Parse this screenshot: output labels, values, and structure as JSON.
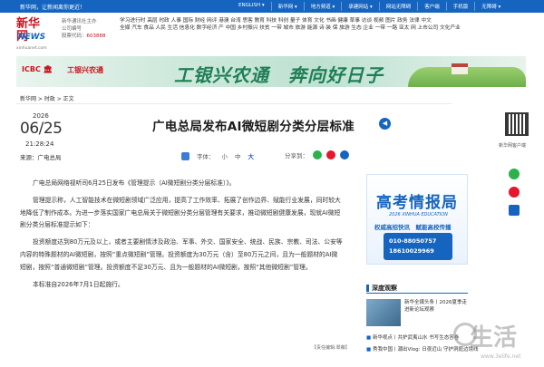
{
  "topbar": {
    "welcome": "新华网，让新闻离你更近！",
    "menu": [
      "ENGLISH ▾",
      "新华网 ▾",
      "地方频道 ▾",
      "承建网站 ▾",
      "网站无障碍",
      "客户端",
      "手机版",
      "无障碍 ▾"
    ]
  },
  "header": {
    "logo_cn": "新华网",
    "logo_en": "NEWS",
    "logo_url": "xinhuanet.com",
    "reg_line1": "新华通讯社主办",
    "reg_line2": "公司编号",
    "reg_line3_prefix": "股票代码：",
    "stock_code": "603888",
    "nav_rows": [
      "学习进行时 高层 时政 人事 国际 财经 网评 港澳 台湾 思客 教育 科技 科创 量子 体育 文化 书画 健康 草事 访谈 视频 图片 政务 法律 中文",
      "全媒 汽车 食品 人民 生活 信息化 数字经济 产 中国 乡村振兴 扶贫 一带 城市 旅游 能源 诗 装 保 旅游 生态 企业 一带 一路 亚太 网 上市公司 文化产业",
      ""
    ]
  },
  "banner": {
    "icbc": "ICBC 🏛",
    "bank": "工银兴农通",
    "slogan": "工银兴农通　奔向好日子"
  },
  "breadcrumb": "新华网 > 时政 > 正文",
  "date": {
    "year": "2026",
    "md": "06/25",
    "time": "21:28:24",
    "source": "来源：广电总局"
  },
  "article": {
    "title": "广电总局发布AI微短剧分类分层标准",
    "audio_icon": "speaker-icon",
    "font_label": "字体：",
    "font_sizes": [
      "小",
      "中",
      "大"
    ],
    "share_label": "分享到：",
    "paragraphs": [
      "广电总局网络视听司6月25日发布《管理提示（AI微短剧分类分层标准）》。",
      "管理提示称，人工智能技术在微短剧领域广泛应用，提高了工作效率、拓展了创作边界、赋能行业发展，同时较大地降低了制作成本。为进一步落实国家广电总局关于微短剧分类分层管理有关要求，推动微短剧健康发展，现就AI微短剧分类分层标准提示如下：",
      "投资额度达到80万元及以上，或者主要剧情涉及政治、军事、外交、国家安全、统战、民族、宗教、司法、公安等内容的特殊题材的AI微短剧，按照“重点微短剧”管理。投资额度为30万元（含）至80万元之间，且为一般题材的AI微短剧，按照“普通微短剧”管理。投资额度不足30万元、且为一般题材的AI微短剧，按照“其他微短剧”管理。",
      "本标准自2026年7月1日起施行。"
    ],
    "editor": "【责任编辑:翠薇】"
  },
  "sidebar": {
    "qr_label": "新华网客户端"
  },
  "ad": {
    "title": "高考情报局",
    "subtitle": "2026 XINHUA EDUCATION",
    "tagline": "权威高招快讯　赋能高校传播",
    "phone1": "010-88050757",
    "phone2": "18610029969"
  },
  "deep": {
    "heading": "深度观察",
    "feature": "新华全媒头条丨2026夏季走进新论坛观察",
    "items": [
      "新华视点丨共护武夷山水 书写生态答卷",
      "秀我中国丨潮出Vlog: 日夜近山 守护洞庭边境线"
    ]
  },
  "watermark": {
    "text": "生活",
    "url": "www.3elife.net"
  },
  "colors": {
    "primary": "#1565c0",
    "brand_red": "#c6141d",
    "banner_green": "#1e7f55"
  }
}
